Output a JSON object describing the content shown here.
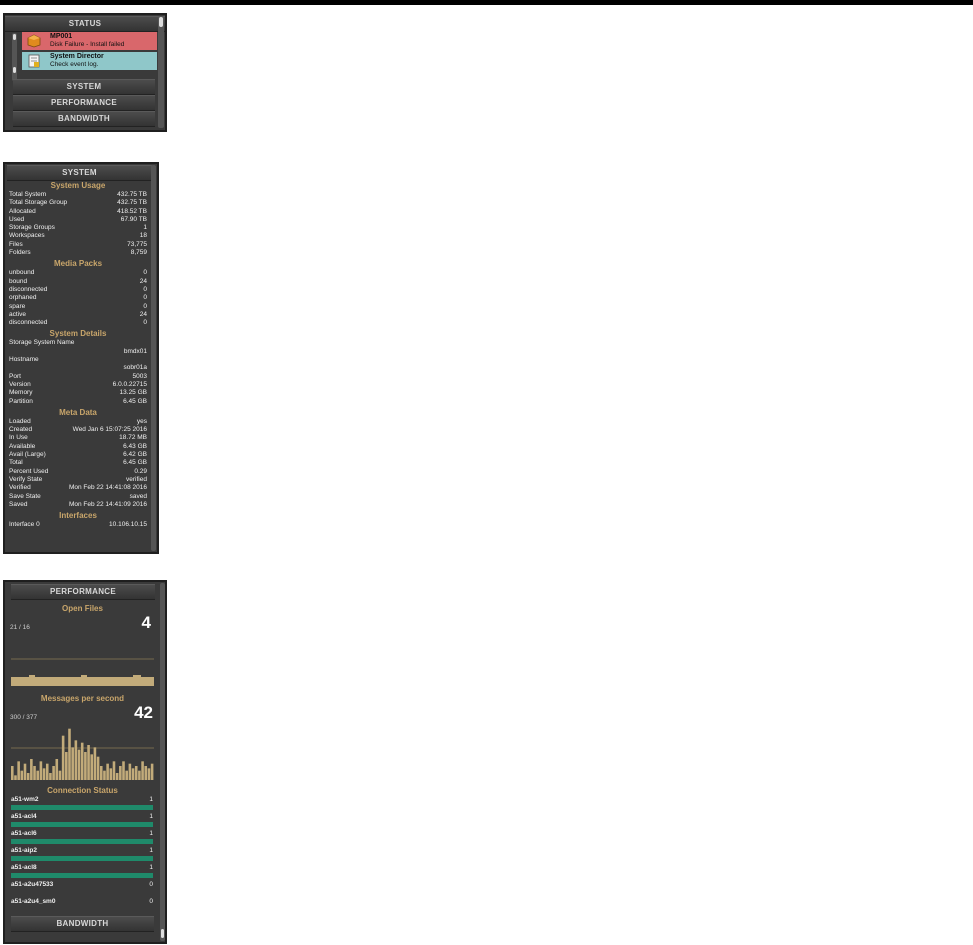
{
  "status_panel": {
    "header": "STATUS",
    "alerts": [
      {
        "title": "MP001",
        "message": "Disk Failure - Install failed",
        "color": "#d9676b",
        "icon": "orange-box-icon"
      },
      {
        "title": "System Director",
        "message": "Check event log.",
        "color": "#8fc7c9",
        "icon": "document-icon"
      }
    ],
    "sections": [
      "SYSTEM",
      "PERFORMANCE",
      "BANDWIDTH"
    ]
  },
  "system_panel": {
    "header": "SYSTEM",
    "usage": {
      "title": "System Usage",
      "rows": [
        {
          "label": "Total System",
          "value": "432.75 TB"
        },
        {
          "label": "Total Storage Group",
          "value": "432.75 TB"
        },
        {
          "label": "Allocated",
          "value": "418.52 TB"
        },
        {
          "label": "Used",
          "value": "67.90 TB"
        },
        {
          "label": "Storage Groups",
          "value": "1"
        },
        {
          "label": "Workspaces",
          "value": "18"
        },
        {
          "label": "Files",
          "value": "73,775"
        },
        {
          "label": "Folders",
          "value": "8,759"
        }
      ]
    },
    "media": {
      "title": "Media Packs",
      "rows": [
        {
          "label": "unbound",
          "value": "0"
        },
        {
          "label": "bound",
          "value": "24"
        },
        {
          "label": "disconnected",
          "value": "0"
        },
        {
          "label": "orphaned",
          "value": "0"
        },
        {
          "label": "spare",
          "value": "0"
        },
        {
          "label": "active",
          "value": "24"
        },
        {
          "label": "disconnected",
          "value": "0"
        }
      ]
    },
    "details": {
      "title": "System Details",
      "storage_name_label": "Storage System Name",
      "storage_name_value": "bmdx01",
      "hostname_label": "Hostname",
      "hostname_value": "sobr01a",
      "rows": [
        {
          "label": "Port",
          "value": "5003"
        },
        {
          "label": "Version",
          "value": "6.0.0.22715"
        },
        {
          "label": "Memory",
          "value": "13.25 GB"
        },
        {
          "label": "Partition",
          "value": "6.45 GB"
        }
      ]
    },
    "meta": {
      "title": "Meta Data",
      "rows": [
        {
          "label": "Loaded",
          "value": "yes"
        },
        {
          "label": "Created",
          "value": "Wed Jan  6 15:07:25 2016"
        },
        {
          "label": "In Use",
          "value": "18.72 MB"
        },
        {
          "label": "Available",
          "value": "6.43 GB"
        },
        {
          "label": "Avail (Large)",
          "value": "6.42 GB"
        },
        {
          "label": "Total",
          "value": "6.45 GB"
        },
        {
          "label": "Percent Used",
          "value": "0.29"
        },
        {
          "label": "Verify State",
          "value": "verified"
        },
        {
          "label": "Verified",
          "value": "Mon Feb 22 14:41:08 2016"
        },
        {
          "label": "Save State",
          "value": "saved"
        },
        {
          "label": "Saved",
          "value": "Mon Feb 22 14:41:09 2016"
        }
      ]
    },
    "interfaces": {
      "title": "Interfaces",
      "rows": [
        {
          "label": "Interface 0",
          "value": "10.106.10.15"
        }
      ]
    }
  },
  "performance_panel": {
    "header": "PERFORMANCE",
    "open_files": {
      "title": "Open Files",
      "value": "4",
      "range": "21 / 16"
    },
    "messages": {
      "title": "Messages per second",
      "value": "42",
      "range": "300 / 377",
      "bars": [
        30,
        10,
        40,
        20,
        35,
        15,
        45,
        30,
        20,
        40,
        25,
        35,
        15,
        30,
        45,
        20,
        95,
        60,
        110,
        70,
        85,
        65,
        80,
        60,
        75,
        55,
        70,
        50,
        30,
        20,
        35,
        25,
        40,
        15,
        30,
        40,
        20,
        35,
        25,
        30,
        20,
        40,
        30,
        25,
        35
      ]
    },
    "connection_status": {
      "title": "Connection Status",
      "items": [
        {
          "name": "a51-wm2",
          "value": "1",
          "active": true
        },
        {
          "name": "a51-acl4",
          "value": "1",
          "active": true
        },
        {
          "name": "a51-acl6",
          "value": "1",
          "active": true
        },
        {
          "name": "a51-aip2",
          "value": "1",
          "active": true
        },
        {
          "name": "a51-acl8",
          "value": "1",
          "active": true
        },
        {
          "name": "a51-a2u47533",
          "value": "0",
          "active": false
        },
        {
          "name": "a51-a2u4_sm0",
          "value": "0",
          "active": false
        }
      ]
    },
    "footer": "BANDWIDTH"
  }
}
